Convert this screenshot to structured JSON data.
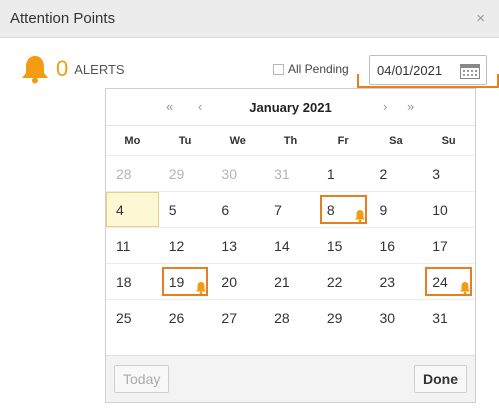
{
  "window": {
    "title": "Attention Points",
    "close_symbol": "×"
  },
  "alerts": {
    "count": "0",
    "label": "ALERTS"
  },
  "filter": {
    "label": "All Pending",
    "checked": false
  },
  "date_input": {
    "value": "04/01/2021"
  },
  "calendar": {
    "month_label": "January 2021",
    "nav": {
      "prev_year": "«",
      "prev_month": "‹",
      "next_month": "›",
      "next_year": "»"
    },
    "weekdays": [
      "Mo",
      "Tu",
      "We",
      "Th",
      "Fr",
      "Sa",
      "Su"
    ],
    "weeks": [
      [
        {
          "d": "28",
          "muted": true
        },
        {
          "d": "29",
          "muted": true
        },
        {
          "d": "30",
          "muted": true
        },
        {
          "d": "31",
          "muted": true
        },
        {
          "d": "1"
        },
        {
          "d": "2"
        },
        {
          "d": "3"
        }
      ],
      [
        {
          "d": "4",
          "today": true
        },
        {
          "d": "5"
        },
        {
          "d": "6"
        },
        {
          "d": "7"
        },
        {
          "d": "8",
          "alert": "1"
        },
        {
          "d": "9"
        },
        {
          "d": "10"
        }
      ],
      [
        {
          "d": "11"
        },
        {
          "d": "12"
        },
        {
          "d": "13"
        },
        {
          "d": "14"
        },
        {
          "d": "15"
        },
        {
          "d": "16"
        },
        {
          "d": "17"
        }
      ],
      [
        {
          "d": "18"
        },
        {
          "d": "19",
          "alert": "1"
        },
        {
          "d": "20"
        },
        {
          "d": "21"
        },
        {
          "d": "22"
        },
        {
          "d": "23"
        },
        {
          "d": "24",
          "alert": "1"
        }
      ],
      [
        {
          "d": "25"
        },
        {
          "d": "26"
        },
        {
          "d": "27"
        },
        {
          "d": "28"
        },
        {
          "d": "29"
        },
        {
          "d": "30"
        },
        {
          "d": "31"
        }
      ]
    ],
    "today_button": "Today",
    "done_button": "Done"
  },
  "colors": {
    "accent": "#f39c12",
    "highlight": "#e67e22",
    "today_bg": "#fcf8d4"
  }
}
